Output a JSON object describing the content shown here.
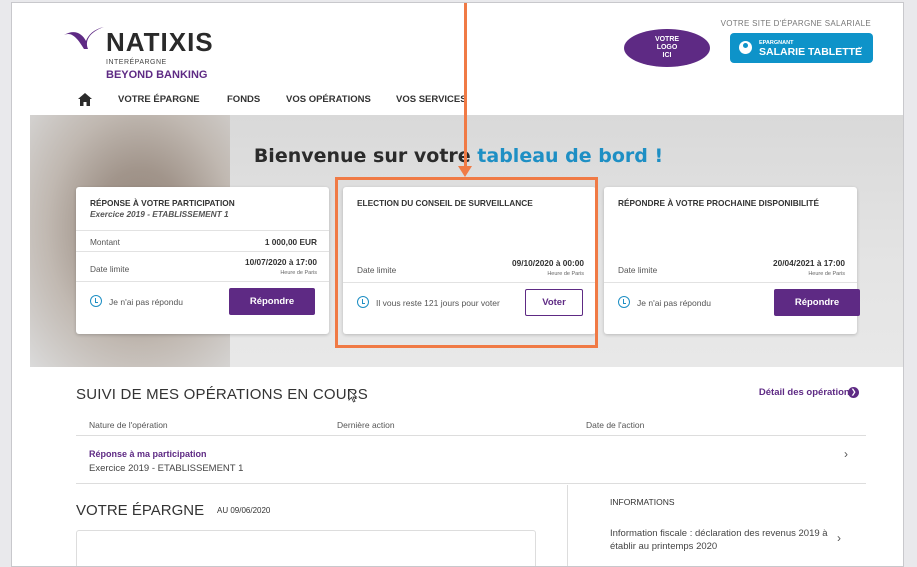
{
  "header": {
    "brand": "NATIXIS",
    "brand_sub1": "INTERÉPARGNE",
    "brand_sub2": "BEYOND BANKING",
    "your_logo_line1": "VOTRE",
    "your_logo_line2": "LOGO",
    "your_logo_line3": "ICI",
    "site_label": "VOTRE SITE D'ÉPARGNE SALARIALE",
    "user_role": "EPARGNANT",
    "user_name": "SALARIE TABLETTE"
  },
  "nav": {
    "items": [
      "VOTRE ÉPARGNE",
      "FONDS",
      "VOS OPÉRATIONS",
      "VOS SERVICES"
    ]
  },
  "hero": {
    "title_prefix": "Bienvenue sur votre",
    "title_highlight": "tableau de bord !"
  },
  "cards": [
    {
      "title": "RÉPONSE À VOTRE PARTICIPATION",
      "subtitle": "Exercice 2019 - ETABLISSEMENT 1",
      "amount_label": "Montant",
      "amount_value": "1 000,00 EUR",
      "deadline_label": "Date limite",
      "deadline_value": "10/07/2020 à 17:00",
      "timezone": "Heure de Paris",
      "status": "Je n'ai pas répondu",
      "action": "Répondre"
    },
    {
      "title": "ELECTION DU CONSEIL DE SURVEILLANCE",
      "deadline_label": "Date limite",
      "deadline_value": "09/10/2020 à 00:00",
      "timezone": "Heure de Paris",
      "status": "Il vous reste 121 jours pour voter",
      "action": "Voter"
    },
    {
      "title": "RÉPONDRE À VOTRE PROCHAINE DISPONIBILITÉ",
      "deadline_label": "Date limite",
      "deadline_value": "20/04/2021 à 17:00",
      "timezone": "Heure de Paris",
      "status": "Je n'ai pas répondu",
      "action": "Répondre"
    }
  ],
  "operations": {
    "title": "SUIVI DE MES OPÉRATIONS EN COURS",
    "detail_link": "Détail des opérations",
    "columns": [
      "Nature de l'opération",
      "Dernière action",
      "Date de l'action"
    ],
    "rows": [
      {
        "name": "Réponse à ma participation",
        "sub": "Exercice 2019 - ETABLISSEMENT 1"
      }
    ]
  },
  "savings": {
    "title": "VOTRE ÉPARGNE",
    "date": "AU 09/06/2020"
  },
  "info": {
    "title": "INFORMATIONS",
    "text": "Information fiscale : déclaration des revenus 2019 à établir au printemps 2020"
  },
  "colors": {
    "accent_purple": "#5e2a84",
    "accent_blue": "#1e8fc4",
    "highlight_orange": "#f07a45"
  }
}
